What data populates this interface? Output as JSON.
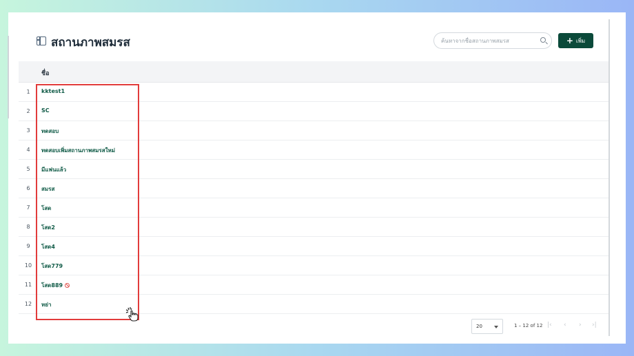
{
  "page": {
    "title": "สถานภาพสมรส"
  },
  "search": {
    "placeholder": "ค้นหาจากชื่อสถานภาพสมรส",
    "value": ""
  },
  "toolbar": {
    "add_label": "เพิ่ม"
  },
  "table": {
    "columns": [
      "ชื่อ"
    ],
    "rows": [
      {
        "num": "1",
        "name": "kktest1",
        "disabled": false
      },
      {
        "num": "2",
        "name": "SC",
        "disabled": false
      },
      {
        "num": "3",
        "name": "ทดสอบ",
        "disabled": false
      },
      {
        "num": "4",
        "name": "ทดสอบเพิ่มสถานภาพสมรสใหม่",
        "disabled": false
      },
      {
        "num": "5",
        "name": "มีแฟนแล้ว",
        "disabled": false
      },
      {
        "num": "6",
        "name": "สมรส",
        "disabled": false
      },
      {
        "num": "7",
        "name": "โสด",
        "disabled": false
      },
      {
        "num": "8",
        "name": "โสด2",
        "disabled": false
      },
      {
        "num": "9",
        "name": "โสด4",
        "disabled": false
      },
      {
        "num": "10",
        "name": "โสด779",
        "disabled": false
      },
      {
        "num": "11",
        "name": "โสด889",
        "disabled": true
      },
      {
        "num": "12",
        "name": "หย่า",
        "disabled": false
      }
    ]
  },
  "pagination": {
    "page_size": "20",
    "range": "1 – 12 of 12",
    "first": "|‹",
    "prev": "‹",
    "next": "›",
    "last": "›|"
  },
  "colors": {
    "accent": "#0b4a3a",
    "link": "#0f5a46",
    "highlight": "#e23b3b"
  }
}
